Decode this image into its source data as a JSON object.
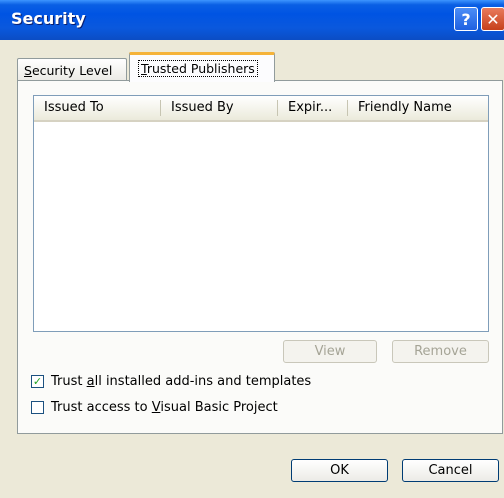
{
  "window": {
    "title": "Security"
  },
  "titlebar": {
    "help_glyph": "?",
    "close_glyph": "✕"
  },
  "tabs": [
    {
      "label_first": "S",
      "label_rest": "ecurity Level",
      "active": false
    },
    {
      "label_first": "T",
      "label_rest": "rusted Publishers",
      "active": true
    }
  ],
  "publishers_list": {
    "columns": [
      "Issued To",
      "Issued By",
      "Expir...",
      "Friendly Name"
    ],
    "rows": []
  },
  "buttons": {
    "view": "View",
    "remove": "Remove",
    "ok": "OK",
    "cancel": "Cancel"
  },
  "options": [
    {
      "pre": "Trust ",
      "key": "a",
      "post": "ll installed add-ins and templates",
      "checked": true
    },
    {
      "pre": "Trust access to ",
      "key": "V",
      "post": "isual Basic Project",
      "checked": false
    }
  ],
  "colors": {
    "titlebar": "#0054E3",
    "dialog_bg": "#ECE9D8",
    "active_tab_highlight": "#F5B339",
    "check_mark": "#21A121"
  }
}
